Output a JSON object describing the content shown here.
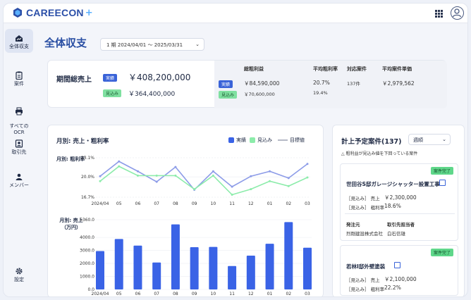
{
  "header": {
    "logo_text": "CAREECON",
    "logo_plus": "+"
  },
  "sidebar": {
    "items": [
      {
        "label": "全体収支",
        "icon": "home-chart-icon"
      },
      {
        "label": "案件",
        "icon": "clipboard-icon"
      },
      {
        "label": "すべての\nOCR",
        "icon": "printer-icon"
      },
      {
        "label": "取引先",
        "icon": "contact-card-icon"
      },
      {
        "label": "メンバー",
        "icon": "person-icon"
      },
      {
        "label": "設定",
        "icon": "gear-icon"
      }
    ]
  },
  "page": {
    "title": "全体収支",
    "period": "1 期 2024/04/01 〜 2025/03/31"
  },
  "summary": {
    "label": "期間総売上",
    "actual_badge": "実績",
    "actual_value": "￥408,200,000",
    "forecast_badge": "見込み",
    "forecast_value": "￥364,400,000",
    "headers": [
      "総粗利益",
      "平均粗利率",
      "対応案件",
      "平均案件単価"
    ],
    "actual_row": {
      "badge": "実績",
      "gross": "￥84,590,000",
      "rate": "20.7%",
      "count": "137件",
      "avg": "￥2,979,562"
    },
    "forecast_row": {
      "badge": "見込み",
      "gross": "￥70,600,000",
      "rate": "19.4%"
    }
  },
  "chart": {
    "title": "月別: 売上・粗利率",
    "legend": [
      "実績",
      "見込み",
      "目標値"
    ],
    "line_label": "月別: 粗利率",
    "bar_label_1": "月別: 売上",
    "bar_label_2": "（万円）"
  },
  "chart_data": [
    {
      "type": "line",
      "title": "月別: 粗利率",
      "categories": [
        "2024/04",
        "05",
        "06",
        "07",
        "08",
        "09",
        "10",
        "11",
        "12",
        "01",
        "02",
        "03"
      ],
      "y_ticks": [
        "23.1%",
        "20.0%",
        "16.7%"
      ],
      "ylim": [
        16.7,
        23.1
      ],
      "series": [
        {
          "name": "実績",
          "values": [
            20.1,
            22.5,
            20.9,
            19.2,
            21.6,
            17.9,
            20.9,
            18.4,
            20.1,
            20.9,
            19.8,
            22.1
          ]
        },
        {
          "name": "見込み",
          "values": [
            19.3,
            21.7,
            20.2,
            20.2,
            20.2,
            18.0,
            20.2,
            17.1,
            18.0,
            19.3,
            18.5,
            19.9
          ]
        },
        {
          "name": "目標値",
          "values": [
            20.0,
            20.0,
            20.0,
            20.0,
            20.0,
            20.0,
            20.0,
            20.0,
            20.0,
            20.0,
            20.0,
            20.0
          ]
        }
      ],
      "colors": {
        "実績": "#8d9ce8",
        "見込み": "#8cecaa",
        "目標値": "#b5bac6"
      }
    },
    {
      "type": "bar",
      "title": "月別: 売上（万円）",
      "categories": [
        "2024/04",
        "05",
        "06",
        "07",
        "08",
        "09",
        "10",
        "11",
        "12",
        "01",
        "02",
        "03"
      ],
      "y_ticks": [
        "5360.0",
        "4000.0",
        "3000.0",
        "2000.0",
        "1000.0",
        "0.0"
      ],
      "ylim": [
        0,
        5360
      ],
      "series": [
        {
          "name": "実績",
          "values": [
            2950,
            3880,
            3370,
            2070,
            5000,
            3250,
            3270,
            1800,
            2600,
            3510,
            5180,
            3210
          ]
        }
      ],
      "colors": {
        "実績": "#3a63e6"
      }
    }
  ],
  "list": {
    "title": "計上予定案件(137)",
    "filter": "週順",
    "warning": "△ 粗利益が見込み値を下回っている案件",
    "items": [
      {
        "badge": "案件完了",
        "name": "世田谷S邸ガレージシャッター設置工事",
        "sales_label": "［見込み］ 売上",
        "sales": "￥2,300,000",
        "rate_label": "［見込み］ 粗利率",
        "rate": "18.6%",
        "client_h": "発注元",
        "client": "烈剛建設株式会社",
        "owner_h": "取引先担当者",
        "owner": "白石信雄"
      },
      {
        "badge": "案件完了",
        "name": "若林I邸外壁塗装",
        "sales_label": "［見込み］ 売上",
        "sales": "￥2,100,000",
        "rate_label": "［見込み］ 粗利率",
        "rate": "22.2%"
      }
    ]
  }
}
